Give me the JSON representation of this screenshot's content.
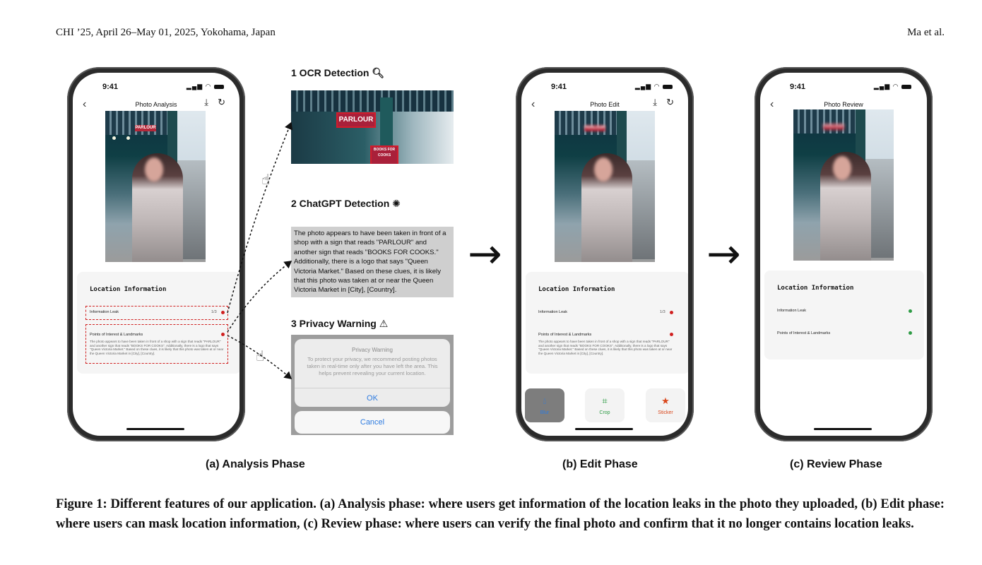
{
  "header": {
    "left": "CHI ’25, April 26–May 01, 2025, Yokohama, Japan",
    "right": "Ma et al."
  },
  "phones": {
    "status_time": "9:41",
    "analysis": {
      "title": "Photo Analysis"
    },
    "edit": {
      "title": "Photo Edit"
    },
    "review": {
      "title": "Photo Review"
    }
  },
  "info": {
    "title": "Location Information",
    "row1": "Information Leak",
    "row1_count": "1/3",
    "row2": "Points of Interest & Landmarks",
    "desc": "The photo appears to have been taken in front of a shop with a sign that reads \"PARLOUR\" and another sign that reads \"BOOKS FOR COOKS\". Additionally, there is a logo that says \"Queen Victoria Market.\" Based on these clues, it is likely that this photo was taken at or near the Queen Victoria Market in [City], [Country]."
  },
  "photo_signs": {
    "parlour": "PARLOUR",
    "books": "BOOKS FOR COOKS"
  },
  "steps": {
    "ocr": "1 OCR Detection",
    "gpt": "2 ChatGPT Detection",
    "warn": "3 Privacy Warning"
  },
  "gpt_text": "The photo appears to have been taken in front of a shop with a sign that reads \"PARLOUR\" and another sign that reads \"BOOKS FOR COOKS.\" Additionally, there is a logo that says \"Queen Victoria Market.\" Based on these clues, it is likely that this photo was taken at or near the Queen Victoria Market in [City], [Country].",
  "warning": {
    "title": "Privacy Warning",
    "body": "To protect your privacy, we recommend posting photos taken in real-time only after you have left the area. This helps prevent revealing your current location.",
    "ok": "OK",
    "cancel": "Cancel"
  },
  "tools": {
    "blur": "Blur",
    "crop": "Crop",
    "sticker": "Sticker"
  },
  "captions": {
    "a": "(a) Analysis Phase",
    "b": "(b) Edit Phase",
    "c": "(c) Review Phase"
  },
  "figure_caption": "Figure 1: Different features of our application. (a) Analysis phase: where users get information of the location leaks in the photo they uploaded, (b) Edit phase: where users can mask location information, (c) Review phase: where users can verify the final photo and confirm that it no longer contains location leaks.",
  "colors": {
    "alert_red": "#d02020",
    "ok_green": "#2e9b45",
    "ios_blue": "#2d7be0",
    "sticker_orange": "#d9461b"
  },
  "icons": [
    "magnifier-icon",
    "openai-icon",
    "warning-triangle-icon",
    "tap-hand-icon",
    "back-chevron-icon",
    "download-icon",
    "undo-icon",
    "droplet-icon",
    "crop-icon",
    "star-icon",
    "right-arrow-icon"
  ]
}
